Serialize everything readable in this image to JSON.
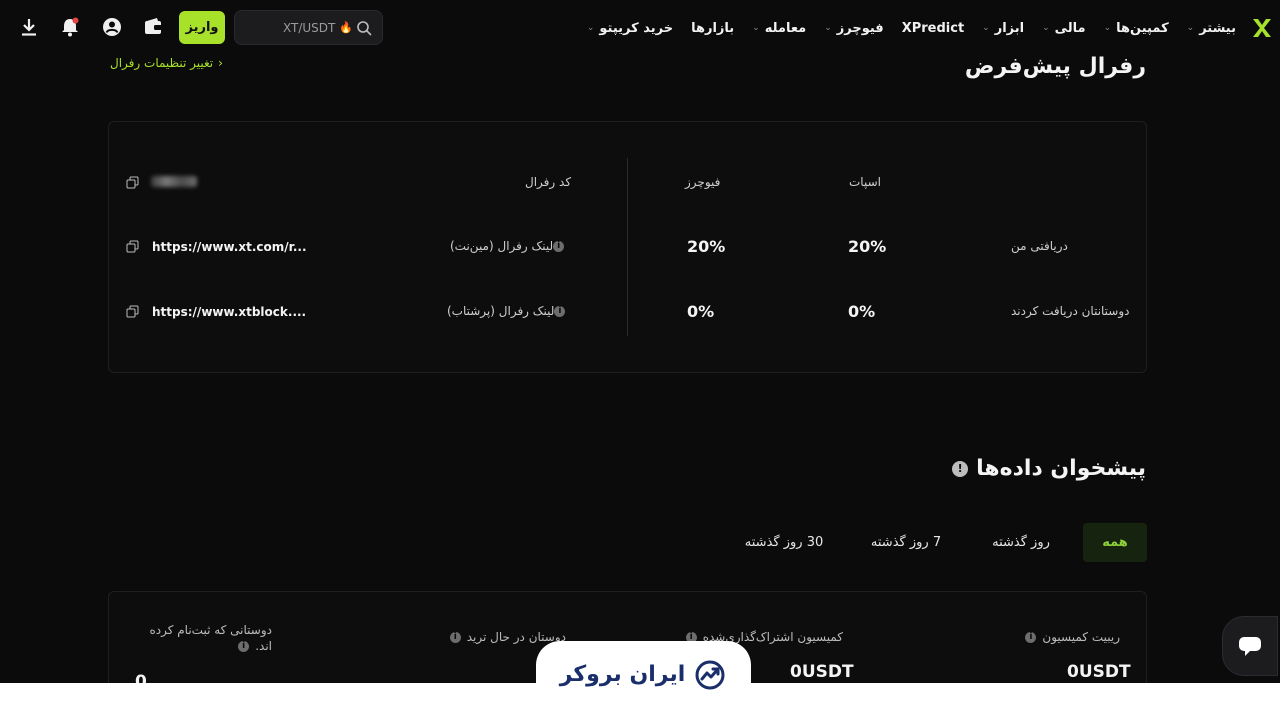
{
  "nav": {
    "items": [
      {
        "label": "خرید کریپتو",
        "chevron": true
      },
      {
        "label": "بازارها",
        "chevron": false
      },
      {
        "label": "معامله",
        "chevron": true
      },
      {
        "label": "فیوچرز",
        "chevron": true
      },
      {
        "label": "XPredict",
        "chevron": false
      },
      {
        "label": "ابزار",
        "chevron": true
      },
      {
        "label": "مالی",
        "chevron": true
      },
      {
        "label": "کمپین‌ها",
        "chevron": true
      },
      {
        "label": "بیشتر",
        "chevron": true
      }
    ],
    "search_text": "XT/USDT",
    "deposit_label": "واریز",
    "accent": "#a8e12a"
  },
  "referral": {
    "change_link": "تغییر تنظیمات رفرال",
    "title": "رفرال پیش‌فرض",
    "columns": {
      "spot": "اسپات",
      "futures": "فیوچرز",
      "code": "کد رفرال"
    },
    "rows": {
      "mine": {
        "label": "دریافتی من",
        "spot": "20%",
        "futures": "20%"
      },
      "friends": {
        "label": "دوستانتان دریافت کردند",
        "spot": "0%",
        "futures": "0%"
      }
    },
    "links": {
      "mainnet_label": "لینک رفرال (مین‌نت)",
      "mainnet_url": "https://www.xt.com/r...",
      "backup_label": "لینک رفرال (پرشتاب)",
      "backup_url": "https://www.xtblock...."
    }
  },
  "dashboard": {
    "title": "پیشخوان داده‌ها",
    "tabs": [
      "همه",
      "روز گذشته",
      "7 روز گذشته",
      "30 روز گذشته"
    ],
    "stats": [
      {
        "label": "ریبیت کمیسیون",
        "value": "0USDT"
      },
      {
        "label": "کمیسیون اشتراک‌گذاری‌شده",
        "value": "0USDT"
      },
      {
        "label": "دوستان در حال ترید",
        "value": ""
      },
      {
        "label": "دوستانی که ثبت‌نام کرده اند.",
        "value": "0"
      }
    ]
  },
  "watermark": {
    "text": "ایران بروکر"
  }
}
